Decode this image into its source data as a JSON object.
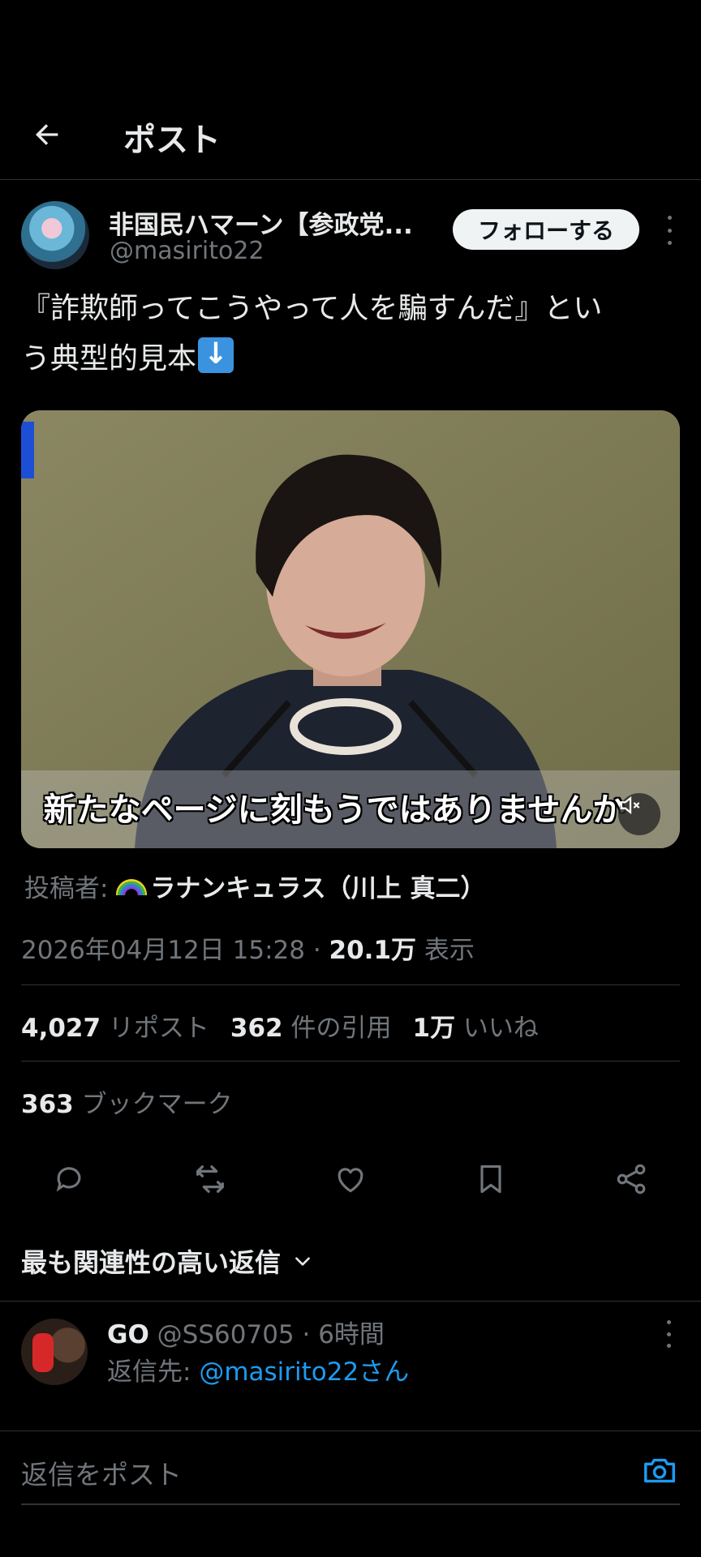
{
  "header": {
    "title": "ポスト",
    "back_icon": "arrow-left-icon"
  },
  "author": {
    "display_name": "非国民ハマーン【参政党...",
    "handle": "@masirito22",
    "follow_label": "フォローする"
  },
  "post": {
    "text_line1": "『詐欺師ってこうやって人を騙すんだ』とい",
    "text_line2": "う典型的見本",
    "emoji": "down-arrow-emoji",
    "video": {
      "subtitle": "新たなページに刻もうではありませんか",
      "mute_icon": "speaker-muted-icon"
    }
  },
  "poster": {
    "prefix": "投稿者: ",
    "name": "ラナンキュラス（川上 真二）"
  },
  "meta": {
    "datetime": "2026年04月12日 15:28",
    "separator": " · ",
    "views": "20.1万",
    "views_label": " 表示"
  },
  "stats": {
    "reposts": "4,027",
    "reposts_label": " リポスト",
    "quotes": "362",
    "quotes_label": " 件の引用",
    "likes": "1万",
    "likes_label": " いいね",
    "bookmarks": "363",
    "bookmarks_label": " ブックマーク"
  },
  "actions": [
    "reply-icon",
    "repost-icon",
    "like-icon",
    "bookmark-icon",
    "share-icon"
  ],
  "replies_sort": {
    "label": "最も関連性の高い返信"
  },
  "reply": {
    "name": "GO",
    "handle": " @SS60705",
    "separator": " · ",
    "time": "6時間",
    "reply_to_prefix": "返信先: ",
    "reply_to": "@masirito22さん"
  },
  "composer": {
    "placeholder": "返信をポスト"
  },
  "colors": {
    "background": "#000000",
    "accent": "#1d9bf0",
    "muted": "#71767b",
    "divider": "#2f3336"
  }
}
